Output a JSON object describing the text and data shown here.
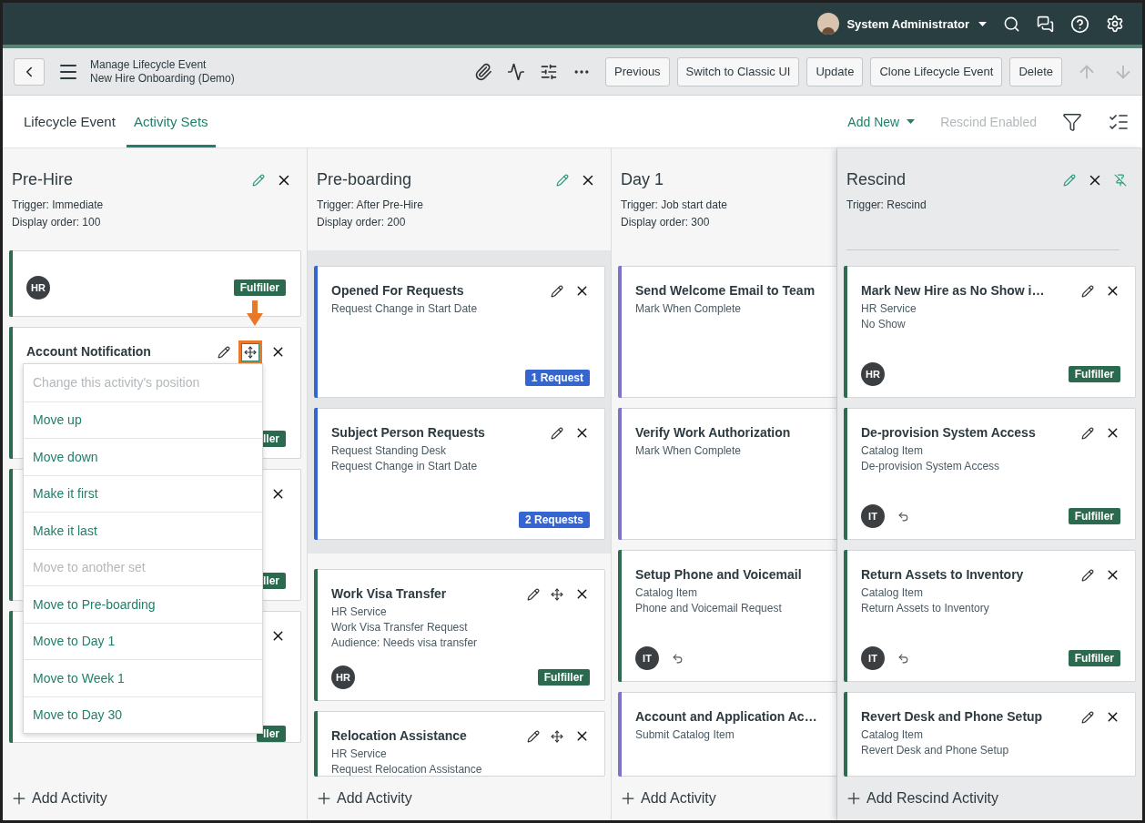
{
  "top_bar": {
    "user_name": "System Administrator"
  },
  "toolbar": {
    "title": "Manage Lifecycle Event",
    "subtitle": "New Hire Onboarding (Demo)",
    "buttons": [
      "Previous",
      "Switch to Classic UI",
      "Update",
      "Clone Lifecycle Event",
      "Delete"
    ]
  },
  "tabs": [
    {
      "label": "Lifecycle Event",
      "selected": false
    },
    {
      "label": "Activity Sets",
      "selected": true
    }
  ],
  "tab_actions": {
    "add_new": "Add New",
    "rescind": {
      "label": "Rescind Enabled",
      "disabled": true
    }
  },
  "columns": [
    {
      "kind": "set",
      "title": "Pre-Hire",
      "details": [
        "Trigger: Immediate",
        "Display order: 100"
      ],
      "add_label": "Add Activity",
      "cards": [
        {
          "kind": "stub",
          "color": "#2e6b50",
          "avatar": "HR",
          "linked": false,
          "highlighted": false,
          "badge": {
            "label": "Fulfiller",
            "kind": "fulfiller"
          }
        },
        {
          "kind": "full",
          "color": "#2e6b50",
          "title": "Account Notification",
          "linked": false,
          "highlighted": true,
          "badge": {
            "label": "ller",
            "kind": "fulfiller"
          },
          "menu": [
            {
              "label": "Change this activity's position",
              "kind": "heading"
            },
            {
              "label": "Move up",
              "kind": "action"
            },
            {
              "label": "Move down",
              "kind": "action"
            },
            {
              "label": "Make it first",
              "kind": "action"
            },
            {
              "label": "Make it last",
              "kind": "action"
            },
            {
              "label": "Move to another set",
              "kind": "heading"
            },
            {
              "label": "Move to Pre-boarding",
              "kind": "action"
            },
            {
              "label": "Move to Day 1",
              "kind": "action"
            },
            {
              "label": "Move to Week 1",
              "kind": "action"
            },
            {
              "label": "Move to Day 30",
              "kind": "action"
            }
          ]
        },
        {
          "kind": "covered",
          "color": "#2e6b50",
          "linked": false,
          "highlighted": false,
          "badge": {
            "label": "ller",
            "kind": "fulfiller"
          }
        },
        {
          "kind": "covered",
          "color": "#2e6b50",
          "linked": false,
          "highlighted": false,
          "badge": {
            "label": "ller",
            "kind": "fulfiller"
          }
        }
      ]
    },
    {
      "kind": "set",
      "title": "Pre-boarding",
      "details": [
        "Trigger: After Pre-Hire",
        "Display order: 200"
      ],
      "add_label": "Add Activity",
      "groups": [
        {
          "shaded": true,
          "cards": [
            {
              "kind": "fixed",
              "color": "#3565d0",
              "title": "Opened For Requests",
              "lines": [
                "Request Change in Start Date"
              ],
              "linked": false,
              "highlighted": false,
              "badge": {
                "label": "1 Request",
                "kind": "request"
              }
            },
            {
              "kind": "fixed",
              "color": "#3565d0",
              "title": "Subject Person Requests",
              "lines": [
                "Request Standing Desk",
                "Request Change in Start Date"
              ],
              "linked": false,
              "highlighted": false,
              "badge": {
                "label": "2 Requests",
                "kind": "request"
              }
            }
          ]
        },
        {
          "shaded": false,
          "cards": [
            {
              "kind": "full",
              "color": "#2e6b50",
              "title": "Work Visa Transfer",
              "lines": [
                "HR Service",
                "Work Visa Transfer Request",
                "Audience: Needs visa transfer"
              ],
              "avatar": "HR",
              "linked": false,
              "highlighted": false,
              "badge": {
                "label": "Fulfiller",
                "kind": "fulfiller"
              }
            },
            {
              "kind": "full",
              "color": "#2e6b50",
              "title": "Relocation Assistance",
              "lines": [
                "HR Service",
                "Request Relocation Assistance"
              ],
              "linked": false,
              "highlighted": false
            }
          ]
        }
      ]
    },
    {
      "kind": "clipped_set",
      "title": "Day 1",
      "details": [
        "Trigger: Job start date",
        "Display order: 300"
      ],
      "add_label": "Add Activity",
      "cards": [
        {
          "kind": "clipped",
          "color": "#7b74c9",
          "title": "Send Welcome Email to Team",
          "lines": [
            "Mark When Complete"
          ],
          "linked": false,
          "highlighted": false
        },
        {
          "kind": "clipped",
          "color": "#7b74c9",
          "title": "Verify Work Authorization",
          "lines": [
            "Mark When Complete"
          ],
          "linked": false,
          "highlighted": false
        },
        {
          "kind": "clipped",
          "color": "#2e6b50",
          "title": "Setup Phone and Voicemail",
          "lines": [
            "Catalog Item",
            "Phone and Voicemail Request"
          ],
          "avatar": "IT",
          "linked": true,
          "highlighted": false
        },
        {
          "kind": "clipped",
          "color": "#7b74c9",
          "title": "Account and Application Ac…",
          "lines": [
            "Submit Catalog Item"
          ],
          "linked": false,
          "highlighted": false
        }
      ]
    },
    {
      "kind": "rescind",
      "title": "Rescind",
      "details": [
        "Trigger: Rescind"
      ],
      "add_label": "Add Rescind Activity",
      "cards": [
        {
          "kind": "fixed",
          "color": "#2e6b50",
          "title": "Mark New Hire as No Show i…",
          "lines": [
            "HR Service",
            "No Show"
          ],
          "avatar": "HR",
          "linked": false,
          "highlighted": false,
          "badge": {
            "label": "Fulfiller",
            "kind": "fulfiller"
          }
        },
        {
          "kind": "fixed",
          "color": "#2e6b50",
          "title": "De-provision System Access",
          "lines": [
            "Catalog Item",
            "De-provision System Access"
          ],
          "avatar": "IT",
          "linked": true,
          "highlighted": false,
          "badge": {
            "label": "Fulfiller",
            "kind": "fulfiller"
          }
        },
        {
          "kind": "fixed",
          "color": "#2e6b50",
          "title": "Return Assets to Inventory",
          "lines": [
            "Catalog Item",
            "Return Assets to Inventory"
          ],
          "avatar": "IT",
          "linked": true,
          "highlighted": false,
          "badge": {
            "label": "Fulfiller",
            "kind": "fulfiller"
          }
        },
        {
          "kind": "fixed",
          "color": "#2e6b50",
          "title": "Revert Desk and Phone Setup",
          "lines": [
            "Catalog Item",
            "Revert Desk and Phone Setup"
          ],
          "linked": false,
          "highlighted": false
        }
      ]
    }
  ]
}
